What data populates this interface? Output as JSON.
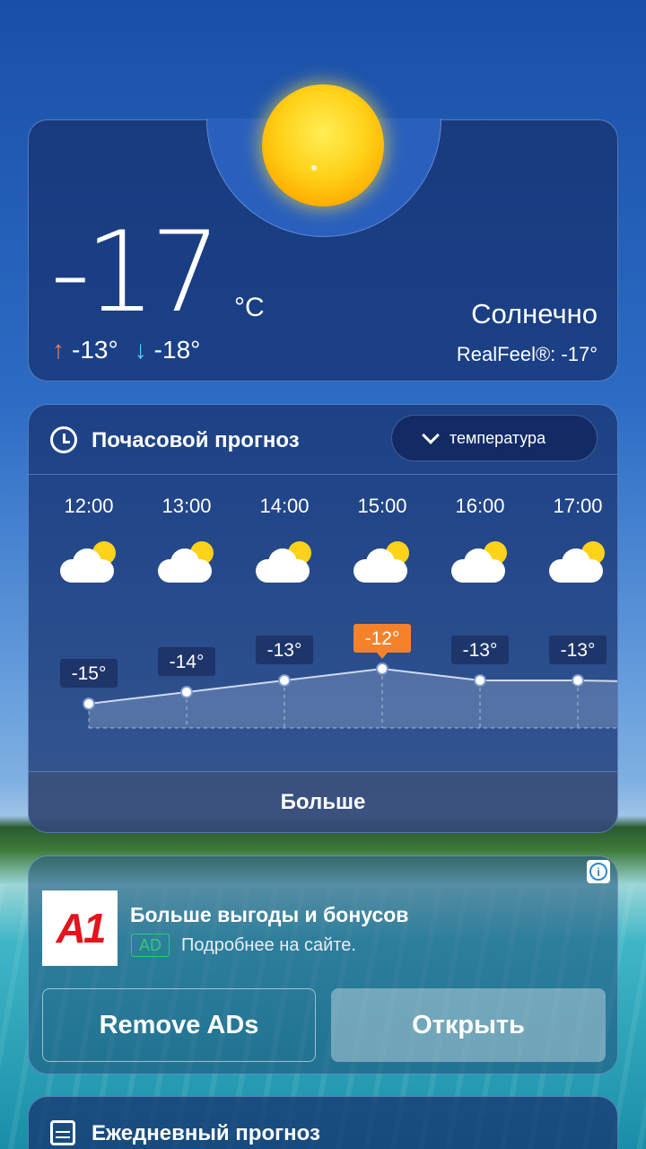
{
  "current": {
    "temperature": "-17",
    "unit": "°C",
    "high": "-13°",
    "low": "-18°",
    "condition": "Солнечно",
    "realfeel": "RealFeel®: -17°",
    "icon": "sun-icon"
  },
  "hourly": {
    "title": "Почасовой прогноз",
    "dropdown_label": "температура",
    "more_label": "Больше",
    "highlight_color": "#f5822a",
    "hours": [
      {
        "time": "12:00",
        "temp": "-15°",
        "value": -15,
        "icon": "partly-cloudy-icon"
      },
      {
        "time": "13:00",
        "temp": "-14°",
        "value": -14,
        "icon": "partly-cloudy-icon"
      },
      {
        "time": "14:00",
        "temp": "-13°",
        "value": -13,
        "icon": "partly-cloudy-icon"
      },
      {
        "time": "15:00",
        "temp": "-12°",
        "value": -12,
        "icon": "partly-cloudy-icon",
        "highlight": true
      },
      {
        "time": "16:00",
        "temp": "-13°",
        "value": -13,
        "icon": "partly-cloudy-icon"
      },
      {
        "time": "17:00",
        "temp": "-13°",
        "value": -13,
        "icon": "partly-cloudy-icon"
      }
    ]
  },
  "ad": {
    "logo_text": "A1",
    "title": "Больше выгоды и бонусов",
    "badge": "AD",
    "subtitle": "Подробнее на сайте.",
    "remove_label": "Remove ADs",
    "open_label": "Открыть"
  },
  "daily": {
    "title": "Ежедневный прогноз"
  }
}
